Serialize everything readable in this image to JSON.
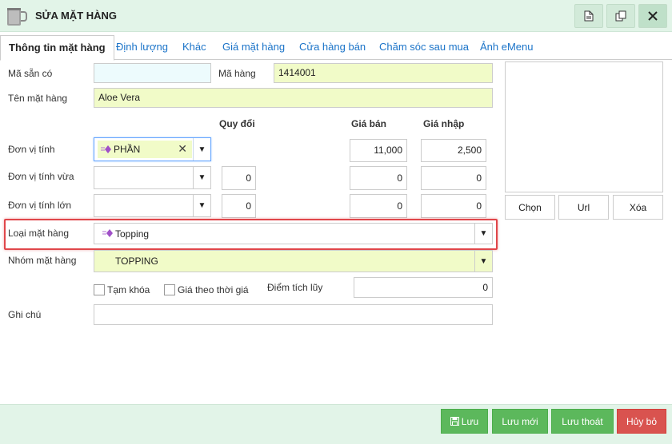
{
  "window": {
    "title": "SỬA MẶT HÀNG",
    "accent_color": "#e2f4e8",
    "actions": [
      "document-icon",
      "copy-icon",
      "close-icon"
    ]
  },
  "tabs": [
    {
      "label": "Thông tin mặt hàng",
      "active": true
    },
    {
      "label": "Định lượng"
    },
    {
      "label": "Khác"
    },
    {
      "label": "Giá mặt hàng"
    },
    {
      "label": "Cửa hàng bán"
    },
    {
      "label": "Chăm sóc sau mua"
    },
    {
      "label": "Ảnh eMenu"
    }
  ],
  "form": {
    "ma_san_co": {
      "label": "Mã sẵn có",
      "value": ""
    },
    "ma_hang": {
      "label": "Mã hàng",
      "value": "1414001"
    },
    "ten_mat_hang": {
      "label": "Tên mặt hàng",
      "value": "Aloe Vera"
    },
    "headers": {
      "quy_doi": "Quy đổi",
      "gia_ban": "Giá bán",
      "gia_nhap": "Giá nhập"
    },
    "don_vi_tinh": {
      "label": "Đơn vị tính",
      "value": "PHẦN",
      "gia_ban": "11,000",
      "gia_nhap": "2,500"
    },
    "don_vi_tinh_vua": {
      "label": "Đơn vị tính vừa",
      "value": "",
      "quy_doi": "0",
      "gia_ban": "0",
      "gia_nhap": "0"
    },
    "don_vi_tinh_lon": {
      "label": "Đơn vị tính lớn",
      "value": "",
      "quy_doi": "0",
      "gia_ban": "0",
      "gia_nhap": "0"
    },
    "loai_mat_hang": {
      "label": "Loại mặt hàng",
      "value": "Topping"
    },
    "nhom_mat_hang": {
      "label": "Nhóm mặt hàng",
      "value": "TOPPING"
    },
    "tam_khoa": {
      "label": "Tạm khóa",
      "checked": false
    },
    "gia_theo_thoi_gia": {
      "label": "Giá theo thời giá",
      "checked": false
    },
    "diem_tich_luy": {
      "label": "Điểm tích lũy",
      "value": "0"
    },
    "ghi_chu": {
      "label": "Ghi chú",
      "value": ""
    }
  },
  "image": {
    "buttons": {
      "chon": "Chọn",
      "url": "Url",
      "xoa": "Xóa"
    }
  },
  "footer": {
    "luu": "Lưu",
    "luu_moi": "Lưu mới",
    "luu_thoat": "Lưu thoát",
    "huy_bo": "Hủy bỏ",
    "colors": {
      "success": "#5cb85c",
      "danger": "#d9534f"
    }
  },
  "highlight_color": "#e0464a"
}
